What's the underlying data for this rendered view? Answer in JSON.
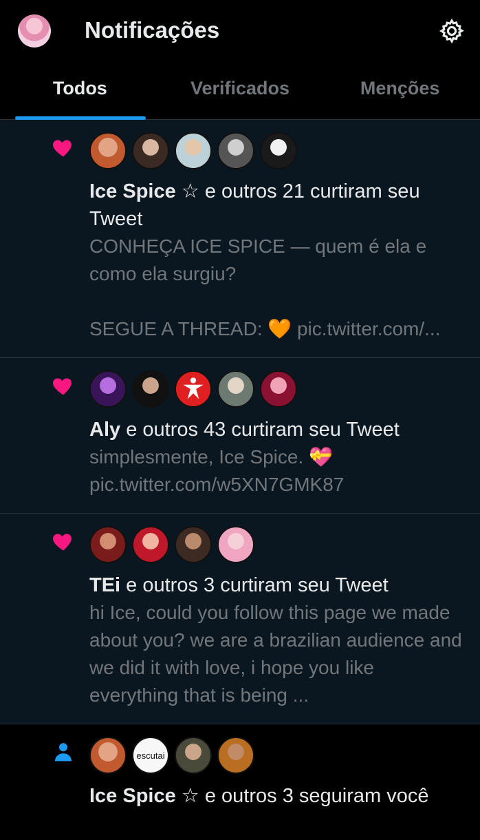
{
  "header": {
    "title": "Notificações"
  },
  "tabs": [
    {
      "label": "Todos"
    },
    {
      "label": "Verificados"
    },
    {
      "label": "Menções"
    }
  ],
  "notifications": [
    {
      "type": "like",
      "actor": "Ice Spice ☆",
      "action": " e outros 21 curtiram seu Tweet",
      "text": "CONHEÇA ICE SPICE — quem é ela e como ela surgiu?\n\nSEGUE A THREAD: 🧡 pic.twitter.com/..."
    },
    {
      "type": "like",
      "actor": "Aly",
      "action": " e outros 43 curtiram seu Tweet",
      "text": "simplesmente, Ice Spice. 💝\npic.twitter.com/w5XN7GMK87"
    },
    {
      "type": "like",
      "actor": "TEi",
      "action": " e outros 3 curtiram seu Tweet",
      "text": "hi Ice, could you follow this page we made about you? we are a brazilian audience and we did it with love, i hope you like everything that is being ..."
    },
    {
      "type": "follow",
      "actor": "Ice Spice ☆",
      "action": " e outros 3 seguiram você",
      "follower_badge": "escutai"
    }
  ],
  "colors": {
    "heart": "#f91880",
    "accent": "#1d9bf0"
  }
}
